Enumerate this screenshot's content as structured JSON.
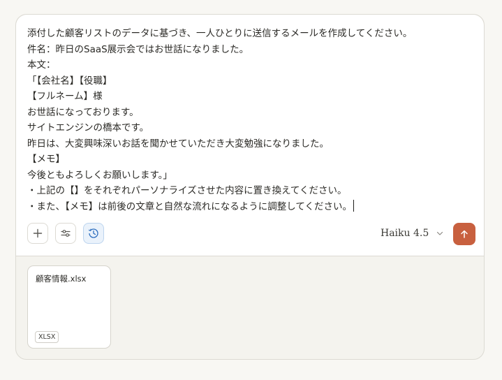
{
  "message": {
    "lines": [
      "添付した顧客リストのデータに基づき、一人ひとりに送信するメールを作成してください。",
      "件名：昨日のSaaS展示会ではお世話になりました。",
      "本文：",
      "「【会社名】【役職】",
      "【フルネーム】様",
      "お世話になっております。",
      "サイトエンジンの橋本です。",
      "昨日は、大変興味深いお話を聞かせていただき大変勉強になりました。",
      "【メモ】",
      "今後ともよろしくお願いします。」",
      "・上記の【】をそれぞれパーソナライズさせた内容に置き換えてください。",
      "・また、【メモ】は前後の文章と自然な流れになるように調整してください。"
    ]
  },
  "toolbar": {
    "buttons": [
      {
        "icon": "plus-icon"
      },
      {
        "icon": "sliders-icon"
      },
      {
        "icon": "clock-icon",
        "active": true
      }
    ],
    "model_label": "Haiku 4.5",
    "send_icon": "arrow-up-icon"
  },
  "attachments": [
    {
      "name": "顧客情報.xlsx",
      "type": "XLSX"
    }
  ],
  "colors": {
    "accent": "#c8603f",
    "active_tool_bg": "#eaf2fb",
    "active_tool_icon": "#2f6fbf"
  }
}
